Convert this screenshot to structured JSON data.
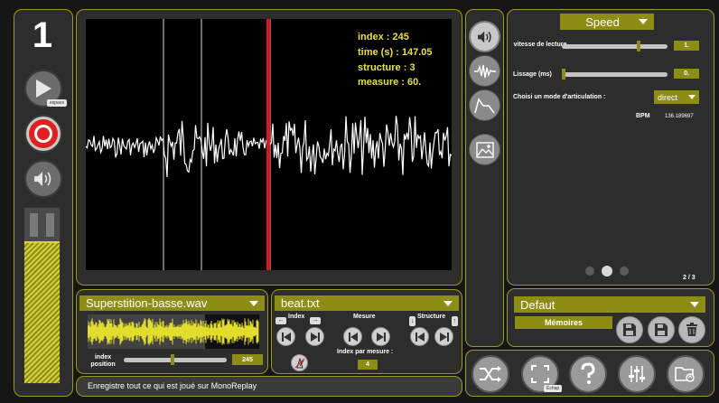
{
  "left": {
    "track_number": "1",
    "play_tooltip": "espace"
  },
  "waveform": {
    "index_label": "index : 245",
    "time_label": "time (s) : 147.05",
    "structure_label": "structure : 3",
    "measure_label": "measure : 60."
  },
  "audio_file": {
    "selected": "Superstition-basse.wav",
    "index_position_label": "index\nposition",
    "index_position_value": "245"
  },
  "beat_file": {
    "selected": "beat.txt",
    "index_label": "Index",
    "mesure_label": "Mesure",
    "structure_label": "Structure",
    "index_par_mesure_label": "Index par mesure :",
    "index_par_mesure_value": "4"
  },
  "status_bar": {
    "message": "Enregistre tout ce qui est joué sur MonoReplay"
  },
  "speed_panel": {
    "mode_selected": "Speed",
    "vitesse_label": "vitesse de lecture",
    "vitesse_value": "1.",
    "lissage_label": "Lissage (ms)",
    "lissage_value": "0.",
    "articulation_label": "Choisi un mode d'articulation :",
    "articulation_selected": "direct",
    "bpm_label": "BPM",
    "bpm_value": "136.189697",
    "page_indicator": "2 / 3"
  },
  "memories": {
    "preset_selected": "Defaut",
    "memoires_label": "Mémoires"
  },
  "bottom_toolbar": {
    "fullscreen_tooltip": "Échap"
  },
  "colors": {
    "accent": "#8d8d15",
    "panel": "#2d2d2d",
    "border": "#9a9a1e",
    "waveform_bg": "#000000",
    "playhead": "#d91818",
    "waveform_text": "#e9e23a"
  }
}
